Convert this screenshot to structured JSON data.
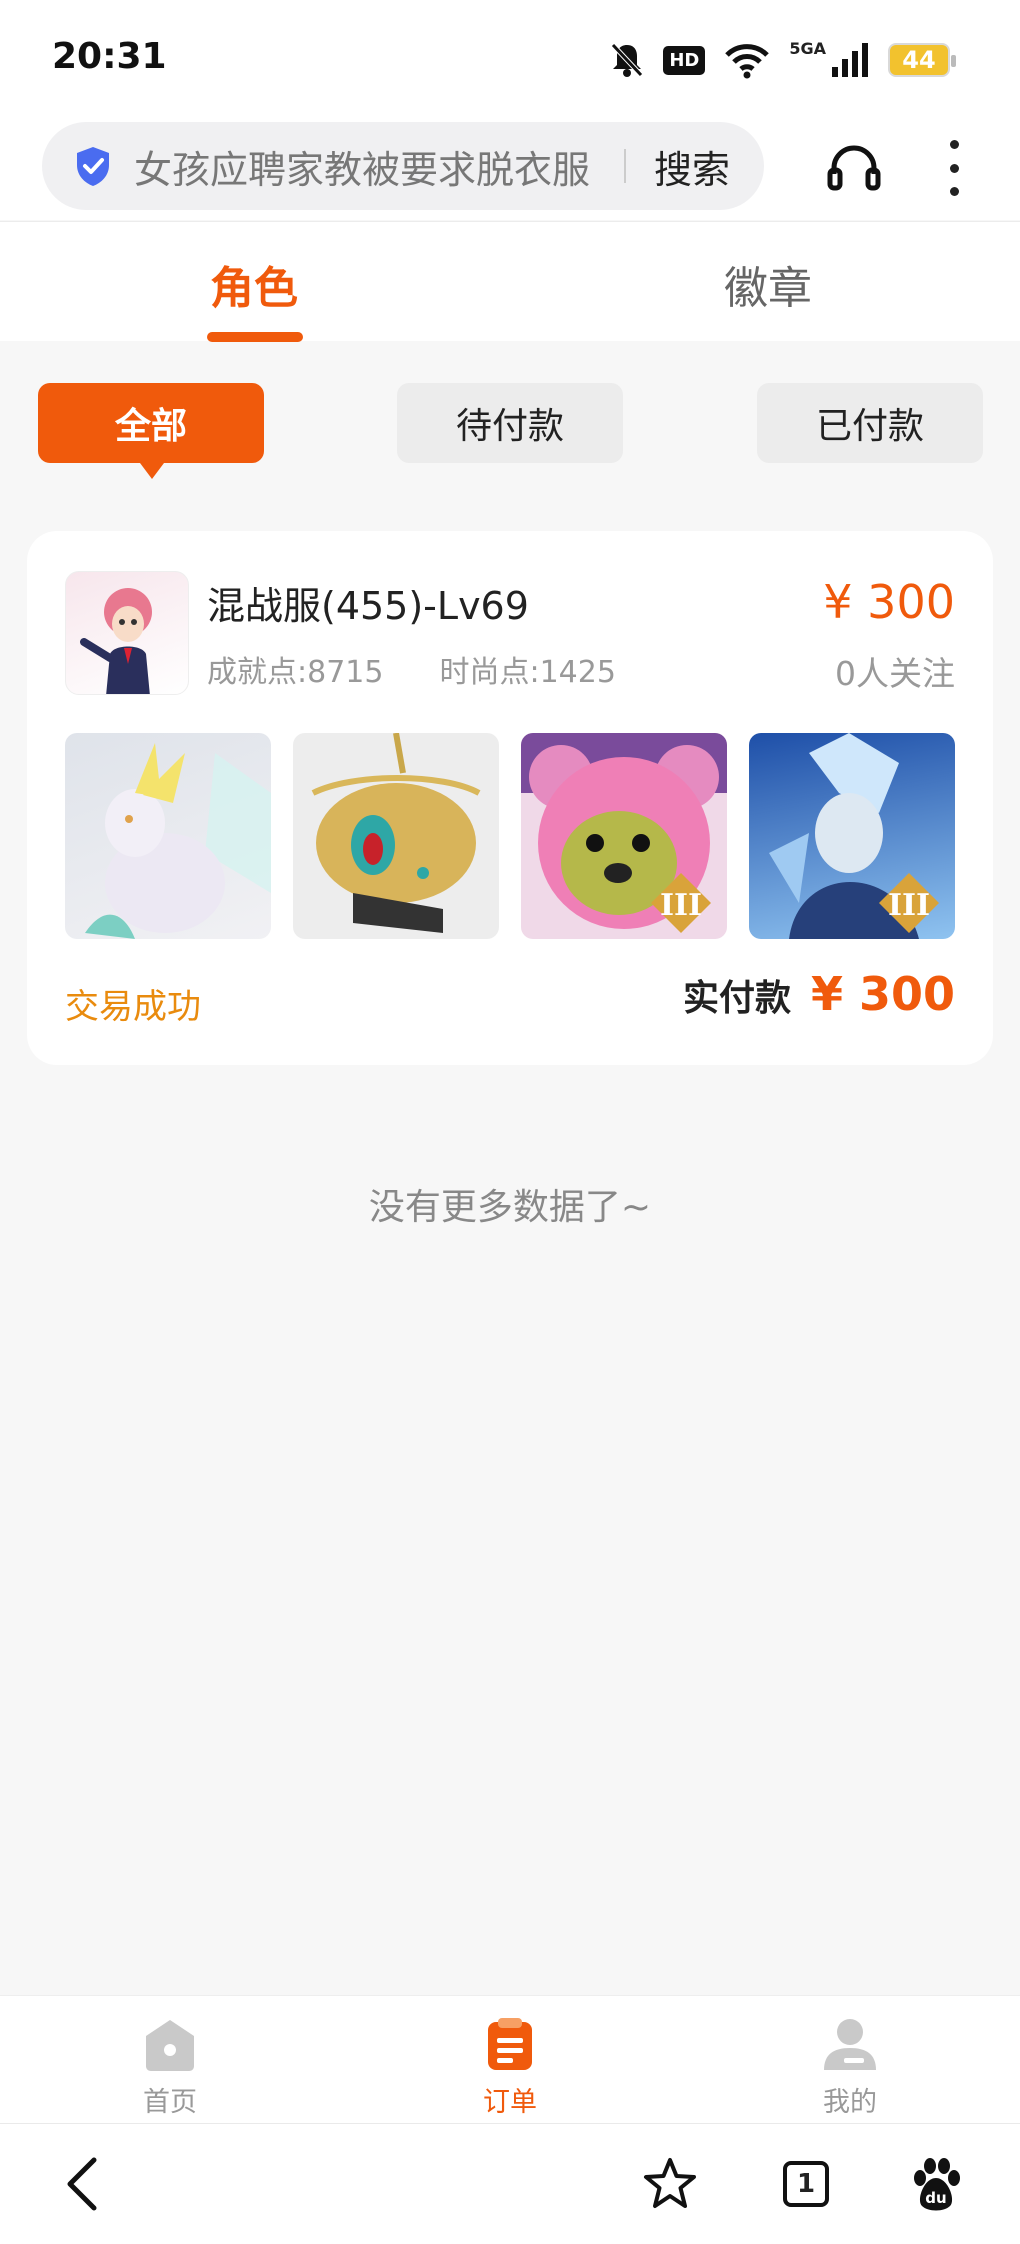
{
  "status_bar": {
    "time": "20:31",
    "network": "5GA",
    "hd": "HD",
    "battery": "44"
  },
  "search": {
    "placeholder": "女孩应聘家教被要求脱衣服",
    "button": "搜索"
  },
  "top_tabs": [
    {
      "label": "角色",
      "active": true
    },
    {
      "label": "徽章",
      "active": false
    }
  ],
  "filters": [
    {
      "label": "全部",
      "active": true
    },
    {
      "label": "待付款",
      "active": false
    },
    {
      "label": "已付款",
      "active": false
    }
  ],
  "order": {
    "server": "混战服(455)-Lv69",
    "achievement": "成就点:8715",
    "fashion": "时尚点:1425",
    "price": "¥ 300",
    "followers": "0人关注",
    "items": [
      {
        "icon": "white-fox-mount-icon"
      },
      {
        "icon": "golden-mask-icon"
      },
      {
        "icon": "pink-bear-icon",
        "tier": "III"
      },
      {
        "icon": "ice-warrior-icon",
        "tier": "III"
      }
    ],
    "status": "交易成功",
    "paid_label": "实付款",
    "paid_value": "¥ 300"
  },
  "no_more": "没有更多数据了~",
  "bottom_nav": [
    {
      "label": "首页",
      "icon": "home-icon",
      "active": false
    },
    {
      "label": "订单",
      "icon": "orders-icon",
      "active": true
    },
    {
      "label": "我的",
      "icon": "profile-icon",
      "active": false
    }
  ],
  "browser_bar": {
    "tab_count": "1"
  },
  "colors": {
    "accent": "#f05a0c",
    "success": "#e98b0e"
  }
}
